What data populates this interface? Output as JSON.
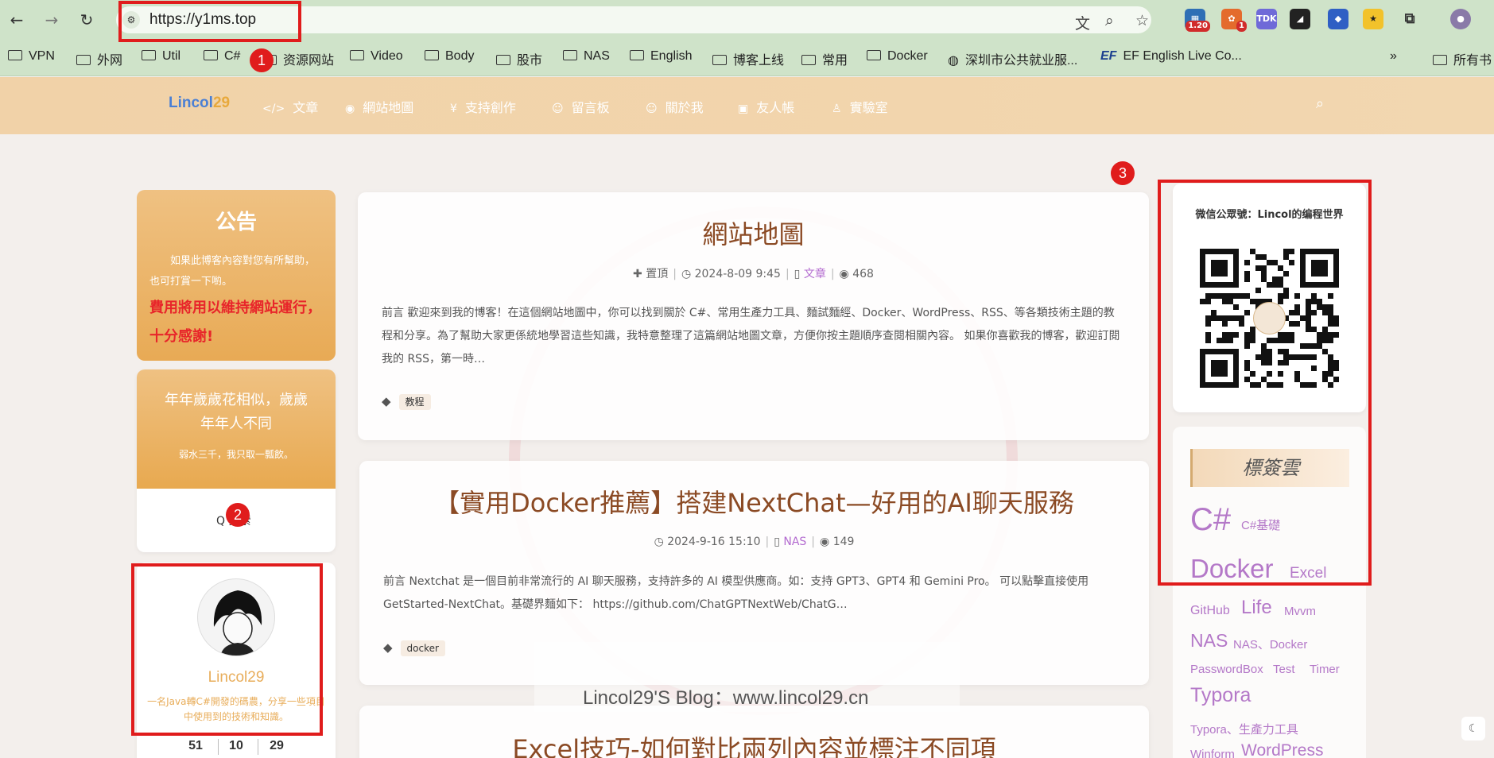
{
  "browser": {
    "url": "https://y1ms.top",
    "extensions": [
      "1.20",
      "1",
      "TDK"
    ],
    "bookmarks": [
      "VPN",
      "外网",
      "Util",
      "C#",
      "资源网站",
      "Video",
      "Body",
      "股市",
      "NAS",
      "English",
      "博客上线",
      "常用",
      "Docker",
      "深圳市公共就业服...",
      "EF English Live Co..."
    ],
    "bookmarks_overflow": "»",
    "all_bookmarks": "所有书"
  },
  "site": {
    "logo_main": "Lincol",
    "logo_tail": "29",
    "nav": [
      {
        "icon": "</>",
        "label": "文章"
      },
      {
        "icon": "◉",
        "label": "網站地圖"
      },
      {
        "icon": "¥",
        "label": "支持創作"
      },
      {
        "icon": "☺",
        "label": "留言板"
      },
      {
        "icon": "☺",
        "label": "關於我"
      },
      {
        "icon": "▣",
        "label": "友人帳"
      },
      {
        "icon": "♙",
        "label": "實驗室"
      }
    ]
  },
  "sidebar_left": {
    "notice_title": "公告",
    "notice_body": "如果此博客內容對您有所幫助，也可打賞一下喲。",
    "notice_emphasis": "費用將用以維持網站運行，十分感謝!",
    "poem_line1": "年年歲歲花相似，歲歲",
    "poem_line2": "年年人不同",
    "poem_sub": "弱水三千，我只取一瓢飲。",
    "search_label": "Q 搜索",
    "profile_name": "Lincol29",
    "profile_desc": "一名Java轉C#開發的碼農，分享一些項目中使用到的技術和知識。",
    "stats": [
      "51",
      "10",
      "29"
    ]
  },
  "posts": [
    {
      "title": "網站地圖",
      "meta_pin": "置頂",
      "meta_date": "2024-8-09 9:45",
      "meta_category": "文章",
      "meta_views": "468",
      "excerpt": "前言 歡迎來到我的博客！在這個網站地圖中，你可以找到關於 C#、常用生產力工具、麵試麵經、Docker、WordPress、RSS、等各類技術主題的教程和分享。為了幫助大家更係統地學習這些知識，我特意整理了這篇網站地圖文章，方便你按主題順序查閱相關內容。 如果你喜歡我的博客，歡迎訂閱我的 RSS，第一時…",
      "tag": "教程"
    },
    {
      "title": "【實用Docker推薦】搭建NextChat—好用的AI聊天服務",
      "meta_date": "2024-9-16 15:10",
      "meta_category": "NAS",
      "meta_views": "149",
      "excerpt": "前言 Nextchat 是一個目前非常流行的 AI 聊天服務，支持許多的 AI 模型供應商。如：支持 GPT3、GPT4 和 Gemini Pro。 可以點擊直接使用 GetStarted-NextChat。基礎界麵如下： https://github.com/ChatGPTNextWeb/ChatG…",
      "tag": "docker"
    },
    {
      "title": "Excel技巧-如何對比兩列內容並標注不同項"
    }
  ],
  "watermark": "Lincol29'S Blog：www.lincol29.cn",
  "sidebar_right": {
    "wechat_title": "微信公眾號：Lincol的编程世界",
    "tagcloud_title": "標簽雲",
    "tags": [
      "C#",
      "C#基礎",
      "Docker",
      "Excel",
      "GitHub",
      "Life",
      "Mvvm",
      "NAS",
      "NAS、Docker",
      "PasswordBox",
      "Test",
      "Timer",
      "Typora",
      "Typora、生產力工具",
      "Winform",
      "WordPress"
    ]
  },
  "annotations": [
    "1",
    "2",
    "3"
  ],
  "colors": {
    "accent": "#e8ad5a",
    "annotation": "#e01c1c",
    "title": "#8b4a24",
    "tag": "#b478c8"
  }
}
